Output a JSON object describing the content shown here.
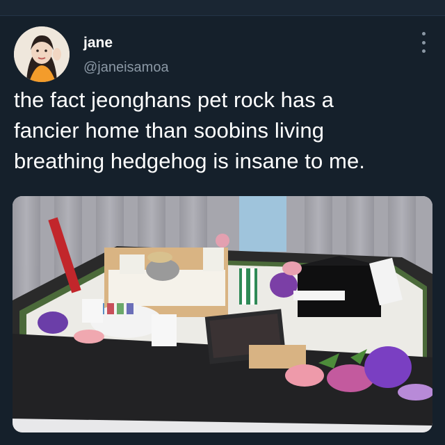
{
  "tweet": {
    "display_name": "jane",
    "handle": "@janeisamoa",
    "text_lines": [
      "the fact jeonghans pet rock has a",
      "fancier home than soobins living",
      "breathing hedgehog is insane to me."
    ],
    "more_icon": "more-vertical-icon"
  },
  "colors": {
    "background": "#15202b",
    "text": "#ffffff",
    "secondary_text": "#8b98a5"
  }
}
